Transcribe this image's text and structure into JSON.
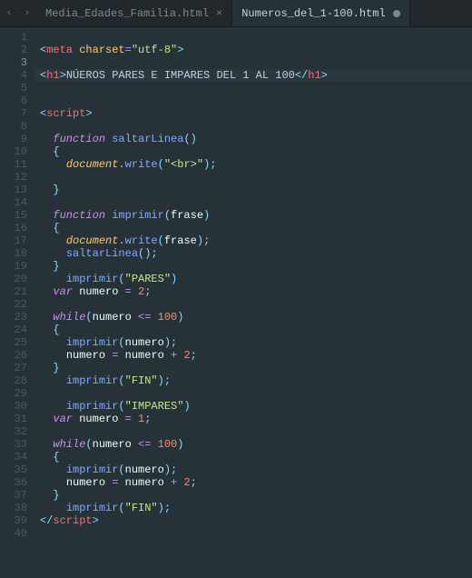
{
  "tabs": {
    "nav_left": "‹",
    "nav_right": "›",
    "items": [
      {
        "label": "Media_Edades_Familia.html",
        "active": false,
        "dirty": false
      },
      {
        "label": "Numeros_del_1-100.html",
        "active": true,
        "dirty": true
      }
    ]
  },
  "gutter": {
    "count": 40,
    "current": 3
  },
  "code": {
    "meta_open": "<",
    "meta_tag": "meta",
    "meta_attr": " charset",
    "meta_eq": "=",
    "meta_val": "\"utf-8\"",
    "meta_close": ">",
    "h1_open1": "<",
    "h1_tag": "h1",
    "h1_open2": ">",
    "h1_text": "NÚEROS PARES E IMPARES DEL 1 AL 100",
    "h1_close1": "</",
    "h1_close2": ">",
    "script_open1": "<",
    "script_tag": "script",
    "script_open2": ">",
    "kw_function": "function",
    "fn_saltar": "saltarLinea",
    "paren_empty": "()",
    "brace_o": "{",
    "brace_c": "}",
    "doc_obj": "document",
    "dot": ".",
    "write_fn": "write",
    "po": "(",
    "pc": ")",
    "semi": ";",
    "br_str": "\"<br>\"",
    "fn_imprimir": "imprimir",
    "param_frase": "frase",
    "call_saltar": "saltarLinea",
    "call_imprimir": "imprimir",
    "pares_str": "\"PARES\"",
    "kw_var": "var",
    "id_numero": "numero",
    "eq": " = ",
    "n2": "2",
    "kw_while": "while",
    "lte": " <= ",
    "n100": "100",
    "plus": " + ",
    "fin_str": "\"FIN\"",
    "impares_str": "\"IMPARES\"",
    "n1": "1",
    "script_close1": "</",
    "script_close2": ">"
  }
}
